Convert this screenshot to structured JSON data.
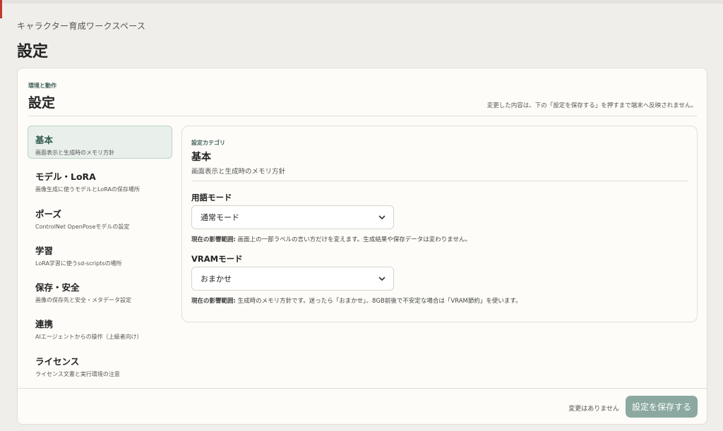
{
  "header": {
    "workspace": "キャラクター育成ワークスペース",
    "title": "設定"
  },
  "card": {
    "eyebrow": "環境と動作",
    "title": "設定",
    "note": "変更した内容は、下の「設定を保存する」を押すまで端末へ反映されません。"
  },
  "nav": {
    "items": [
      {
        "label": "基本",
        "desc": "画面表示と生成時のメモリ方針",
        "active": true
      },
      {
        "label": "モデル・LoRA",
        "desc": "画像生成に使うモデルとLoRAの保存場所"
      },
      {
        "label": "ポーズ",
        "desc": "ControlNet OpenPoseモデルの設定"
      },
      {
        "label": "学習",
        "desc": "LoRA学習に使うsd-scriptsの場所"
      },
      {
        "label": "保存・安全",
        "desc": "画像の保存先と安全・メタデータ設定"
      },
      {
        "label": "連携",
        "desc": "AIエージェントからの操作（上級者向け）"
      },
      {
        "label": "ライセンス",
        "desc": "ライセンス文書と実行環境の注意"
      }
    ]
  },
  "panel": {
    "eyebrow": "設定カテゴリ",
    "title": "基本",
    "subtitle": "画面表示と生成時のメモリ方針",
    "term_mode": {
      "label": "用語モード",
      "value": "通常モード",
      "help_prefix": "現在の影響範囲:",
      "help_text": " 画面上の一部ラベルの言い方だけを変えます。生成結果や保存データは変わりません。"
    },
    "vram_mode": {
      "label": "VRAMモード",
      "value": "おまかせ",
      "help_prefix": "現在の影響範囲:",
      "help_text": " 生成時のメモリ方針です。迷ったら「おまかせ」、8GB前後で不安定な場合は「VRAM節約」を使います。"
    }
  },
  "footer": {
    "status": "変更はありません",
    "save_label": "設定を保存する"
  },
  "colors": {
    "accent": "#8ba9a0",
    "active_nav_bg": "#e9f0ec",
    "eyebrow": "#3f5f58"
  }
}
